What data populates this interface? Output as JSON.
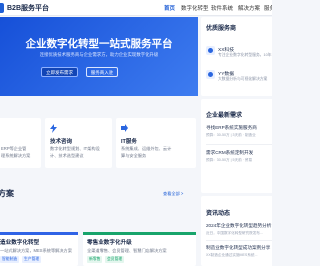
{
  "header": {
    "brand": "B2B服务平台",
    "nav": [
      "首页",
      "数字化转型",
      "软件系统",
      "解决方案",
      "服务"
    ]
  },
  "hero": {
    "title": "企业数字化转型一站式服务平台",
    "subtitle": "连接优质技术服务商与企业需求方，助力企业实现数字化升级",
    "primary_button": "立即发布需求",
    "secondary_button": "服务商入驻"
  },
  "features": [
    {
      "icon": "shield-icon",
      "name": "",
      "desc": [
        "ERP等企业管",
        "理系统解决方案"
      ]
    },
    {
      "icon": "lightning-icon",
      "name": "技术咨询",
      "desc": [
        "数字化转型规划、IT架构设",
        "计、技术选型建议"
      ]
    },
    {
      "icon": "arrow-icon",
      "name": "IT服务",
      "desc": [
        "系统集成、运维外包、云计",
        "算与安全服务"
      ]
    }
  ],
  "solutions": {
    "heading": "方案",
    "more": "查看全部 >",
    "items": [
      {
        "name": "造业数字化转型",
        "desc": "一站式解决方案，MES系统等解决方案",
        "tags": [
          "智能制造",
          "生产管理"
        ],
        "accent": "#2f63e6"
      },
      {
        "name": "零售业数字化升级",
        "desc": "全渠道零售、会员管理、智慧门店解决方案",
        "tags": [
          "新零售",
          "会员管理"
        ],
        "accent": "#18a46b"
      }
    ]
  },
  "sidebar": {
    "providers_title": "优质服务商",
    "providers": [
      {
        "name": "XX科技",
        "desc": "专注企业数字化转型服务，10年"
      },
      {
        "name": "YY数据",
        "desc": "大数据分析与可视化解决方案"
      }
    ],
    "demands_title": "企业最新需求",
    "demands_more": "更多",
    "demands": [
      {
        "title": "寻找ERP系统实施服务商",
        "meta": "预算：30-50万 | 3天前 · 制造业"
      },
      {
        "title": "需求CRM系统定制开发",
        "meta": "预算：30-50万 | 5天前 · 贸易"
      }
    ],
    "news_title": "资讯动态",
    "news": [
      {
        "title": "2024年企业数字化转型趋势分析",
        "meta": "近日，中国数字化转型研究院发布..."
      },
      {
        "title": "制造业数字化转型成功案例分享",
        "meta": "XX制造企业通过实施MES系统..."
      }
    ]
  }
}
